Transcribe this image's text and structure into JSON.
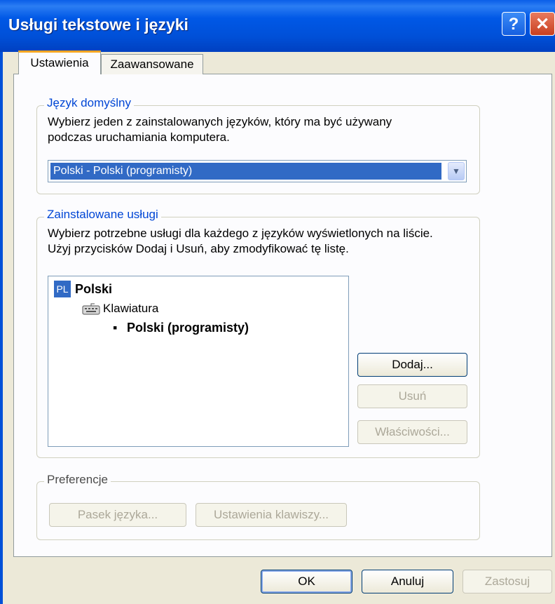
{
  "window": {
    "title": "Usługi tekstowe i języki",
    "help_button": "?",
    "close_button": "✕"
  },
  "tabs": [
    {
      "label": "Ustawienia",
      "active": true
    },
    {
      "label": "Zaawansowane",
      "active": false
    }
  ],
  "default_language": {
    "legend": "Język domyślny",
    "description_line1": "Wybierz jeden z zainstalowanych języków, który ma być używany",
    "description_line2": "podczas uruchamiania komputera.",
    "selected_value": "Polski - Polski (programisty)"
  },
  "installed_services": {
    "legend": "Zainstalowane usługi",
    "description_line1": "Wybierz potrzebne usługi dla każdego z języków wyświetlonych na liście.",
    "description_line2": "Użyj przycisków Dodaj i Usuń, aby zmodyfikować tę listę.",
    "tree": {
      "lang_code": "PL",
      "lang_name": "Polski",
      "category": "Klawiatura",
      "bullet": "▪",
      "layout": "Polski (programisty)"
    },
    "buttons": {
      "add": "Dodaj...",
      "remove": "Usuń",
      "properties": "Właściwości..."
    }
  },
  "preferences": {
    "legend": "Preferencje",
    "language_bar_button": "Pasek języka...",
    "key_settings_button": "Ustawienia klawiszy..."
  },
  "footer": {
    "ok": "OK",
    "cancel": "Anuluj",
    "apply": "Zastosuj"
  },
  "colors": {
    "titlebar": "#0058e6",
    "dialog_bg": "#ECE9D8",
    "selection": "#316ac5",
    "group_legend": "#0046d5",
    "disabled_text": "#aca899"
  }
}
